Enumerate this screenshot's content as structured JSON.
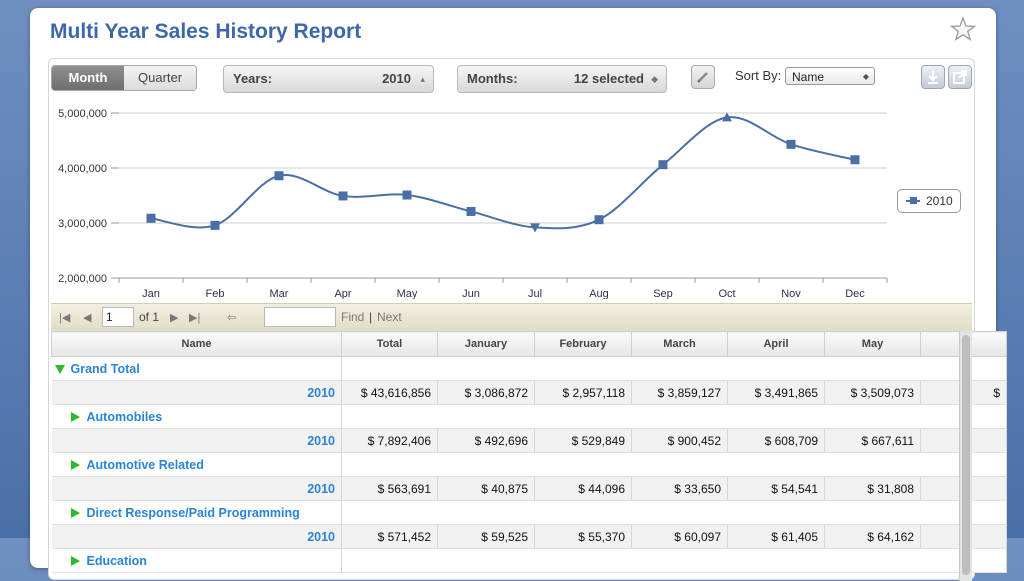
{
  "report": {
    "title": "Multi Year Sales History Report"
  },
  "toolbar": {
    "view_month": "Month",
    "view_quarter": "Quarter",
    "years_label": "Years:",
    "years_value": "2010",
    "months_label": "Months:",
    "months_value": "12 selected",
    "sort_label": "Sort By:",
    "sort_value": "Name"
  },
  "chart_data": {
    "type": "line",
    "categories": [
      "Jan",
      "Feb",
      "Mar",
      "Apr",
      "May",
      "Jun",
      "Jul",
      "Aug",
      "Sep",
      "Oct",
      "Nov",
      "Dec"
    ],
    "series": [
      {
        "name": "2010",
        "values": [
          3086872,
          2957118,
          3859127,
          3491865,
          3509073,
          3210000,
          2920000,
          3060000,
          4060000,
          4920000,
          4430000,
          4150000
        ]
      }
    ],
    "yticks": [
      "5,000,000",
      "4,000,000",
      "3,000,000",
      "2,000,000"
    ],
    "ylim": [
      2000000,
      5000000
    ],
    "legend": "right",
    "grid": true,
    "color": "#4a6fa5"
  },
  "pager": {
    "page": "1",
    "of": "of 1",
    "find": "Find",
    "sep": "|",
    "next": "Next"
  },
  "table": {
    "headers": [
      "Name",
      "Total",
      "January",
      "February",
      "March",
      "April",
      "May",
      ""
    ],
    "rows": [
      {
        "group": "Grand Total",
        "expanded": true,
        "year": "2010",
        "values": [
          "$ 43,616,856",
          "$ 3,086,872",
          "$ 2,957,118",
          "$ 3,859,127",
          "$ 3,491,865",
          "$ 3,509,073",
          "$"
        ]
      },
      {
        "group": "Automobiles",
        "expanded": false,
        "year": "2010",
        "values": [
          "$ 7,892,406",
          "$ 492,696",
          "$ 529,849",
          "$ 900,452",
          "$ 608,709",
          "$ 667,611",
          ""
        ]
      },
      {
        "group": "Automotive Related",
        "expanded": false,
        "year": "2010",
        "values": [
          "$ 563,691",
          "$ 40,875",
          "$ 44,096",
          "$ 33,650",
          "$ 54,541",
          "$ 31,808",
          ""
        ]
      },
      {
        "group": "Direct Response/Paid Programming",
        "expanded": false,
        "year": "2010",
        "values": [
          "$ 571,452",
          "$ 59,525",
          "$ 55,370",
          "$ 60,097",
          "$ 61,405",
          "$ 64,162",
          ""
        ]
      },
      {
        "group": "Education",
        "expanded": false
      }
    ]
  }
}
